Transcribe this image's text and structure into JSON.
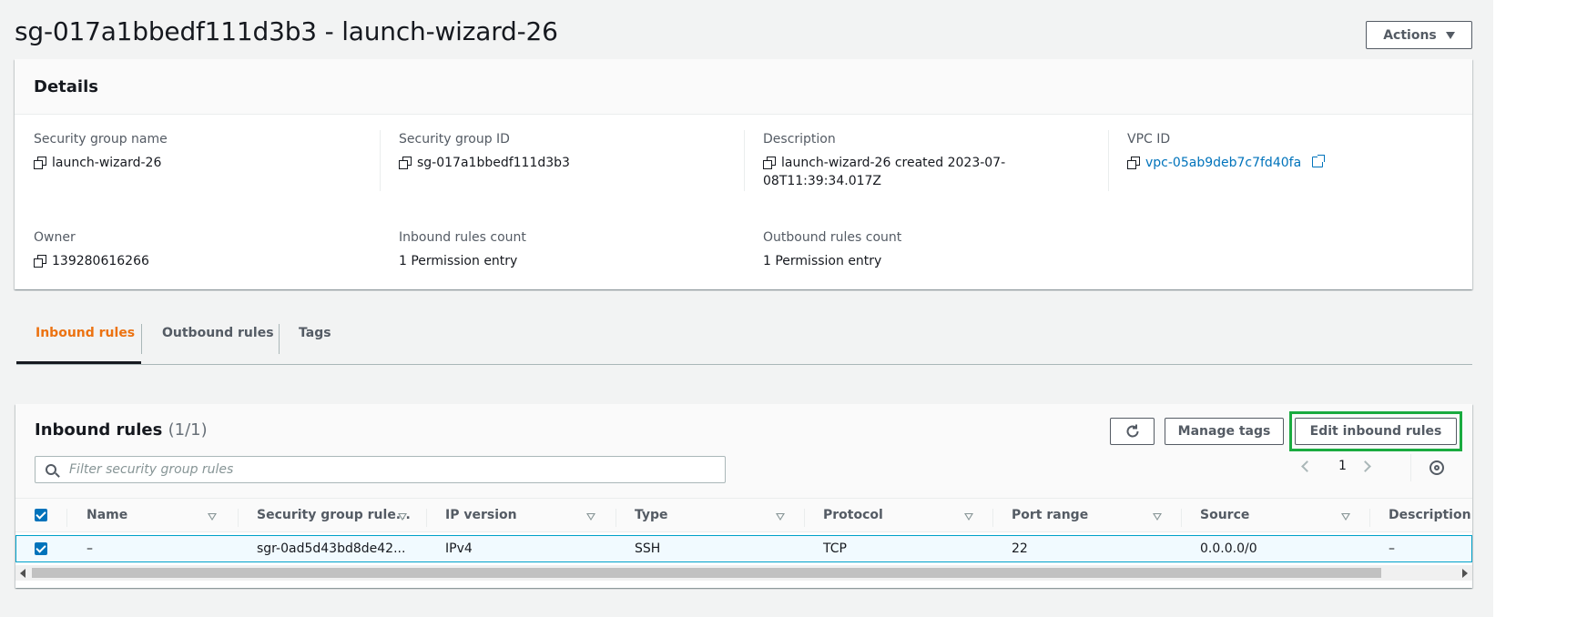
{
  "header": {
    "title": "sg-017a1bbedf111d3b3 - launch-wizard-26",
    "actions_label": "Actions"
  },
  "details": {
    "title": "Details",
    "fields": [
      {
        "label": "Security group name",
        "value": "launch-wizard-26"
      },
      {
        "label": "Security group ID",
        "value": "sg-017a1bbedf111d3b3"
      },
      {
        "label": "Description",
        "value_line1": "launch-wizard-26 created 2023-07-",
        "value_line2": "08T11:39:34.017Z"
      },
      {
        "label": "VPC ID",
        "value": "vpc-05ab9deb7c7fd40fa"
      },
      {
        "label": "Owner",
        "value": "139280616266"
      },
      {
        "label": "Inbound rules count",
        "value": "1 Permission entry"
      },
      {
        "label": "Outbound rules count",
        "value": "1 Permission entry"
      }
    ]
  },
  "tabs": [
    {
      "label": "Inbound rules",
      "active": true
    },
    {
      "label": "Outbound rules",
      "active": false
    },
    {
      "label": "Tags",
      "active": false
    }
  ],
  "rules": {
    "title": "Inbound rules",
    "count": "(1/1)",
    "manage_tags_label": "Manage tags",
    "edit_label": "Edit inbound rules",
    "search_placeholder": "Filter security group rules",
    "page": "1",
    "columns": [
      "Name",
      "Security group rule...",
      "IP version",
      "Type",
      "Protocol",
      "Port range",
      "Source",
      "Description"
    ],
    "row": [
      "–",
      "sgr-0ad5d43bd8de42...",
      "IPv4",
      "SSH",
      "TCP",
      "22",
      "0.0.0.0/0",
      "–"
    ]
  },
  "colors": {
    "accent": "#ec7211",
    "link": "#0073bb",
    "highlight": "#1aab40"
  }
}
